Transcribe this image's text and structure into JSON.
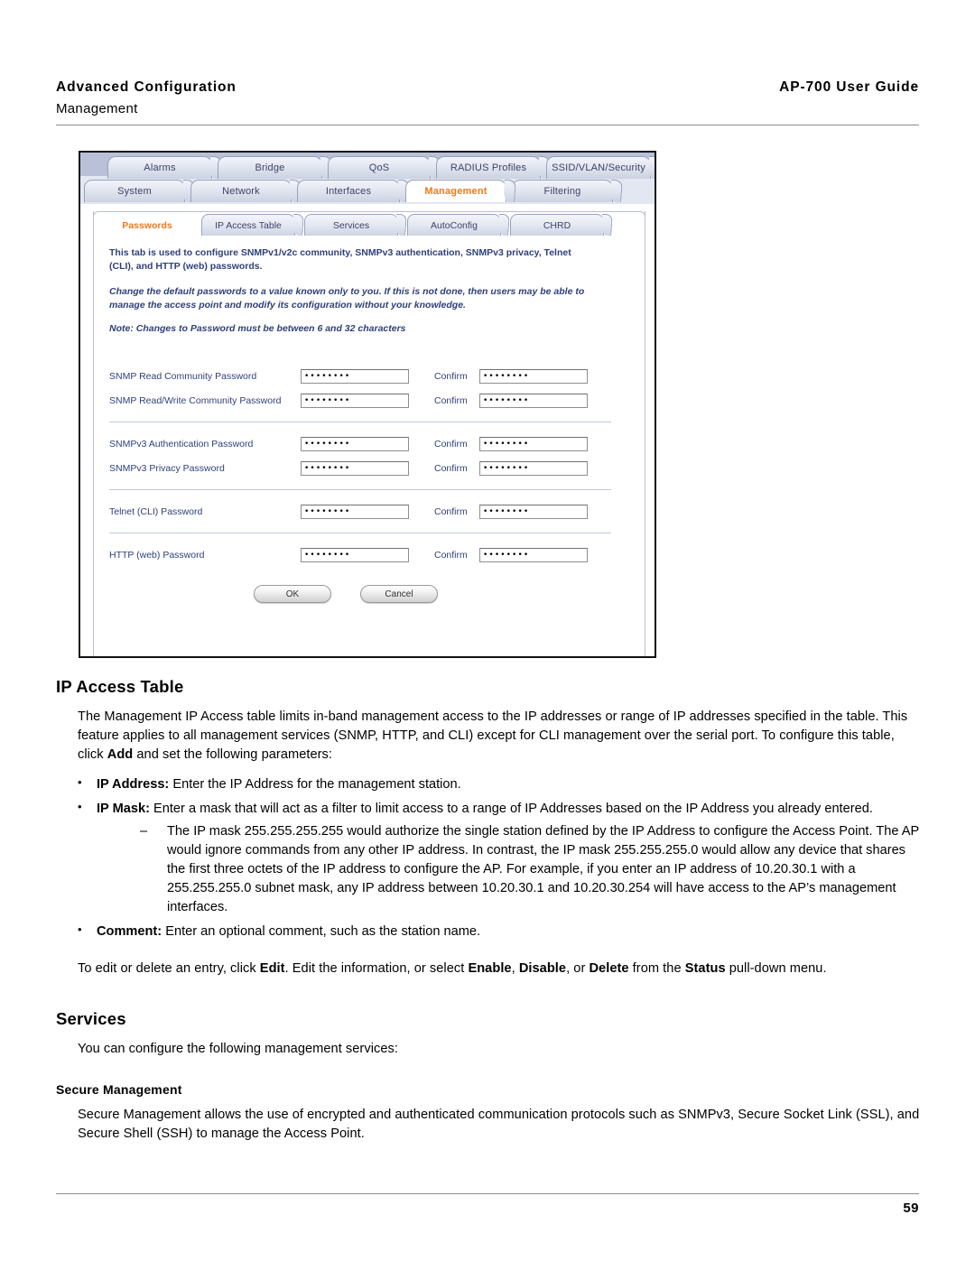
{
  "header": {
    "left_title": "Advanced Configuration",
    "right_title": "AP-700 User Guide",
    "subtitle": "Management"
  },
  "screenshot": {
    "tabs_row1": [
      {
        "label": "Alarms",
        "active": false
      },
      {
        "label": "Bridge",
        "active": false
      },
      {
        "label": "QoS",
        "active": false
      },
      {
        "label": "RADIUS Profiles",
        "active": false
      },
      {
        "label": "SSID/VLAN/Security",
        "active": false
      }
    ],
    "tabs_row2": [
      {
        "label": "System",
        "active": false
      },
      {
        "label": "Network",
        "active": false
      },
      {
        "label": "Interfaces",
        "active": false
      },
      {
        "label": "Management",
        "active": true
      },
      {
        "label": "Filtering",
        "active": false
      }
    ],
    "subtabs": [
      {
        "label": "Passwords",
        "active": true
      },
      {
        "label": "IP Access Table",
        "active": false
      },
      {
        "label": "Services",
        "active": false
      },
      {
        "label": "AutoConfig",
        "active": false
      },
      {
        "label": "CHRD",
        "active": false
      }
    ],
    "intro_line1": "This tab is used to configure  SNMPv1/v2c community, SNMPv3 authentication, SNMPv3 privacy, Telnet",
    "intro_line2": "(CLI), and HTTP (web) passwords.",
    "warning_line1": "Change the default passwords to a value known only to you. If this is not done, then users may be able to",
    "warning_line2": "manage the access point and modify its configuration without your knowledge.",
    "note": "Note: Changes to Password must be between 6 and 32 characters",
    "confirm_label": "Confirm",
    "masked_value": "••••••••",
    "fields_group1": [
      {
        "label": "SNMP Read Community Password"
      },
      {
        "label": "SNMP Read/Write Community Password"
      }
    ],
    "fields_group2": [
      {
        "label": "SNMPv3 Authentication Password"
      },
      {
        "label": "SNMPv3 Privacy Password"
      }
    ],
    "fields_group3": [
      {
        "label": "Telnet (CLI) Password"
      }
    ],
    "fields_group4": [
      {
        "label": "HTTP (web) Password"
      }
    ],
    "ok_label": "OK",
    "cancel_label": "Cancel",
    "accent_active_tab": "#f07818",
    "tab_text_color": "#3c4366",
    "panel_text_color": "#2f3f7a"
  },
  "doc": {
    "section1_heading": "IP Access Table",
    "section1_p1_a": "The Management IP Access table limits in-band management access to the IP addresses or range of IP addresses specified in the table. This feature applies to all management services (SNMP, HTTP, and CLI) except for CLI management over the serial port. To configure this table, click ",
    "section1_p1_bold": "Add",
    "section1_p1_b": " and set the following parameters:",
    "bullet1_bold": "IP Address:",
    "bullet1_text": " Enter the IP Address for the management station.",
    "bullet2_bold": "IP Mask:",
    "bullet2_text": " Enter a mask that will act as a filter to limit access to a range of IP Addresses based on the IP Address you already entered.",
    "dash1_text": "The IP mask 255.255.255.255 would authorize the single station defined by the IP Address to configure the Access Point. The AP would ignore commands from any other IP address. In contrast, the IP mask 255.255.255.0 would allow any device that shares the first three octets of the IP address to configure the AP. For example, if you enter an IP address of 10.20.30.1 with a 255.255.255.0 subnet mask, any IP address between 10.20.30.1 and 10.20.30.254 will have access to the AP’s management interfaces.",
    "bullet3_bold": "Comment:",
    "bullet3_text": " Enter an optional comment, such as the station name.",
    "edit_p_a": "To edit or delete an entry, click ",
    "edit_p_b1": "Edit",
    "edit_p_b": ". Edit the information, or select ",
    "edit_p_b2": "Enable",
    "edit_p_c": ", ",
    "edit_p_b3": "Disable",
    "edit_p_d": ", or ",
    "edit_p_b4": "Delete",
    "edit_p_e": " from the ",
    "edit_p_b5": "Status",
    "edit_p_f": " pull-down menu.",
    "section2_heading": "Services",
    "section2_p1": "You can configure the following management services:",
    "section2_sub_heading": "Secure Management",
    "section2_p2": "Secure Management allows the use of encrypted and authenticated communication protocols such as SNMPv3, Secure Socket Link (SSL), and Secure Shell (SSH) to manage the Access Point."
  },
  "footer": {
    "page_number": "59"
  }
}
